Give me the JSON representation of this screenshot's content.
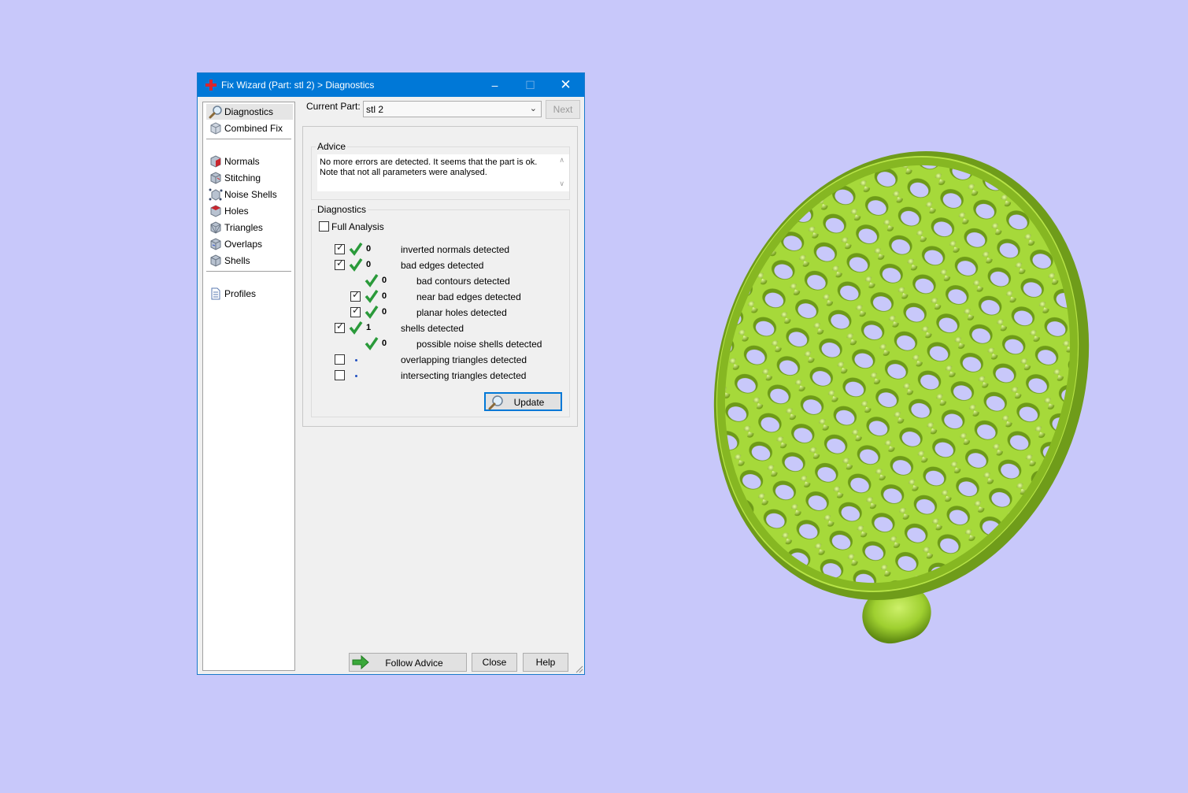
{
  "window": {
    "title": "Fix Wizard (Part: stl 2) > Diagnostics",
    "controls": {
      "minimize": "–",
      "maximize": "☐",
      "close": "✕"
    }
  },
  "nav": {
    "items": [
      {
        "label": "Diagnostics",
        "icon": "magnifier-icon",
        "selected": true
      },
      {
        "label": "Combined Fix",
        "icon": "cube-icon"
      },
      {
        "label": "Normals",
        "icon": "normals-cube-icon"
      },
      {
        "label": "Stitching",
        "icon": "stitching-cube-icon"
      },
      {
        "label": "Noise Shells",
        "icon": "noise-shells-icon"
      },
      {
        "label": "Holes",
        "icon": "holes-cube-icon"
      },
      {
        "label": "Triangles",
        "icon": "triangles-cube-icon"
      },
      {
        "label": "Overlaps",
        "icon": "overlaps-cube-icon"
      },
      {
        "label": "Shells",
        "icon": "shells-cube-icon"
      },
      {
        "label": "Profiles",
        "icon": "document-icon"
      }
    ]
  },
  "part": {
    "label": "Current Part:",
    "value": "stl 2",
    "next": "Next"
  },
  "advice": {
    "title": "Advice",
    "text": "No more errors are detected. It seems that the part is ok. Note that not all parameters were analysed."
  },
  "diagnostics": {
    "title": "Diagnostics",
    "full_analysis": {
      "label": "Full Analysis",
      "checked": false
    },
    "rows": [
      {
        "checked": true,
        "has_checkbox": true,
        "status": "ok",
        "count": "0",
        "label": "inverted normals detected",
        "indent": 0
      },
      {
        "checked": true,
        "has_checkbox": true,
        "status": "ok",
        "count": "0",
        "label": "bad edges detected",
        "indent": 0
      },
      {
        "checked": false,
        "has_checkbox": false,
        "status": "ok",
        "count": "0",
        "label": "bad contours detected",
        "indent": 1
      },
      {
        "checked": true,
        "has_checkbox": true,
        "status": "ok",
        "count": "0",
        "label": "near bad edges detected",
        "indent": 1
      },
      {
        "checked": true,
        "has_checkbox": true,
        "status": "ok",
        "count": "0",
        "label": "planar holes detected",
        "indent": 1
      },
      {
        "checked": true,
        "has_checkbox": true,
        "status": "ok",
        "count": "1",
        "label": "shells detected",
        "indent": 0
      },
      {
        "checked": false,
        "has_checkbox": false,
        "status": "ok",
        "count": "0",
        "label": "possible noise shells detected",
        "indent": 1
      },
      {
        "checked": false,
        "has_checkbox": true,
        "status": "pending",
        "count": "",
        "label": "overlapping triangles detected",
        "indent": 0
      },
      {
        "checked": false,
        "has_checkbox": true,
        "status": "pending",
        "count": "",
        "label": "intersecting triangles detected",
        "indent": 0
      }
    ],
    "update": "Update"
  },
  "footer": {
    "follow_advice": "Follow Advice",
    "close": "Close",
    "help": "Help"
  },
  "colors": {
    "accent": "#0078d7",
    "background": "#c8c8fa",
    "model": "#9fd030",
    "ok": "#2a9a3a"
  }
}
